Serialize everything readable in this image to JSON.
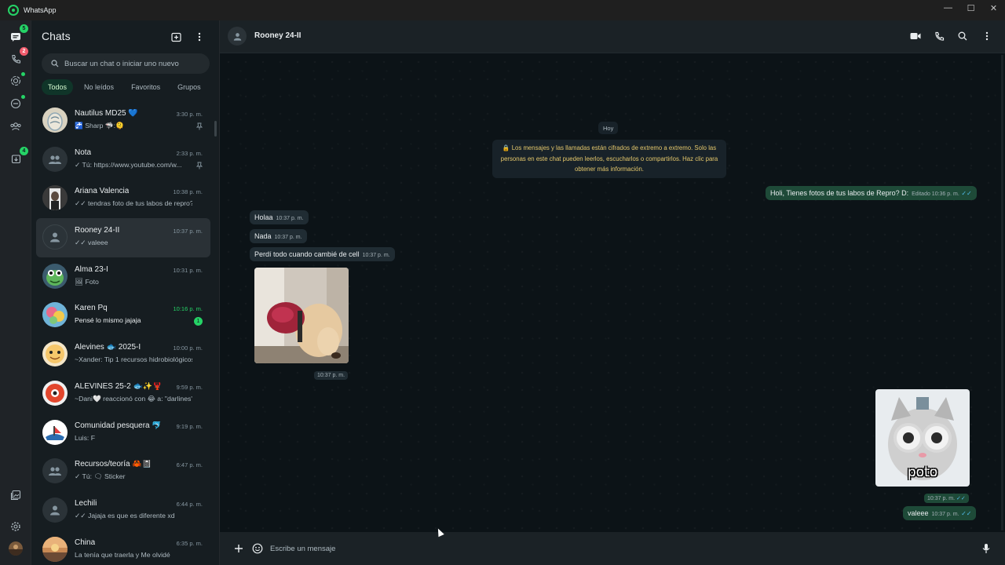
{
  "window": {
    "title": "WhatsApp",
    "controls": {
      "minimize": "—",
      "maximize": "☐",
      "close": "✕"
    }
  },
  "rail": {
    "chats_badge": "5",
    "calls_badge": "2",
    "archive_badge": "4"
  },
  "sidebar": {
    "title": "Chats",
    "search_placeholder": "Buscar un chat o iniciar uno nuevo",
    "filters": [
      "Todos",
      "No leídos",
      "Favoritos",
      "Grupos"
    ],
    "chats": [
      {
        "name": "Nautilus MD25 💙",
        "time": "3:30 p. m.",
        "preview": "🚰 Sharp 🦈:🫠",
        "pinned": true,
        "avatar": "snail"
      },
      {
        "name": "Nota",
        "time": "2:33 p. m.",
        "preview": "✓ Tú: https://www.youtube.com/w...",
        "pinned": true,
        "avatar": "group"
      },
      {
        "name": "Ariana Valencia",
        "time": "10:38 p. m.",
        "preview": "✓✓ tendras foto de tus labos de repro?",
        "avatar": "portrait"
      },
      {
        "name": "Rooney 24-II",
        "time": "10:37 p. m.",
        "preview": "✓✓ valeee",
        "avatar": "person"
      },
      {
        "name": "Alma 23-I",
        "time": "10:31 p. m.",
        "preview": "🖼 Foto",
        "avatar": "frog"
      },
      {
        "name": "Karen Pq",
        "time": "10:16 p. m.",
        "preview": "Pensé lo mismo jajaja",
        "unread": "1",
        "avatar": "colorful"
      },
      {
        "name": "Alevines 🐟 2025-I",
        "time": "10:00 p. m.",
        "preview": "~Xander: Tip 1 recursos hidrobiológicos",
        "avatar": "fish"
      },
      {
        "name": "ALEVINES 25-2 🐟✨🦞",
        "time": "9:59 p. m.",
        "preview": "~Dani🤍 reaccionó con 😂 a: \"darlines\"",
        "avatar": "red"
      },
      {
        "name": "Comunidad pesquera 🐬",
        "time": "9:19 p. m.",
        "preview": "Luis: F",
        "avatar": "boat"
      },
      {
        "name": "Recursos/teoría 🦀📓",
        "time": "6:47 p. m.",
        "preview": "✓ Tú: 🗨 Sticker",
        "avatar": "group"
      },
      {
        "name": "Lechili",
        "time": "6:44 p. m.",
        "preview": "✓✓ Jajaja es que es diferente xd",
        "avatar": "person"
      },
      {
        "name": "China",
        "time": "6:35 p. m.",
        "preview": "La tenía que traerla y  Me olvidé",
        "avatar": "sunset"
      }
    ]
  },
  "conversation": {
    "contact_name": "Rooney 24-II",
    "day_label": "Hoy",
    "encryption_notice": "🔒 Los mensajes y las llamadas están cifrados de extremo a extremo. Solo las personas en este chat pueden leerlos, escucharlos o compartirlos. Haz clic para obtener más información.",
    "messages": [
      {
        "dir": "out",
        "text": "Holi, Tienes fotos de tus labos de Repro? D:",
        "meta": "Editado 10:36 p. m.",
        "ticks": "✓✓"
      },
      {
        "dir": "in",
        "text": "Holaa",
        "meta": "10:37 p. m."
      },
      {
        "dir": "in",
        "text": "Nada",
        "meta": "10:37 p. m."
      },
      {
        "dir": "in",
        "text": "Perdí todo cuando cambié de cell",
        "meta": "10:37 p. m."
      },
      {
        "dir": "in",
        "type": "photo",
        "meta": "10:37 p. m."
      },
      {
        "dir": "out",
        "type": "sticker",
        "sticker_caption": "poto",
        "meta": "10:37 p. m.",
        "ticks": "✓✓"
      },
      {
        "dir": "out",
        "text": "valeee",
        "meta": "10:37 p. m.",
        "ticks": "✓✓"
      }
    ],
    "composer_placeholder": "Escribe un mensaje"
  },
  "colors": {
    "accent": "#25d366",
    "outgoing_bubble": "#1e4a38",
    "incoming_bubble": "#202c33",
    "read_ticks": "#53bdeb"
  }
}
